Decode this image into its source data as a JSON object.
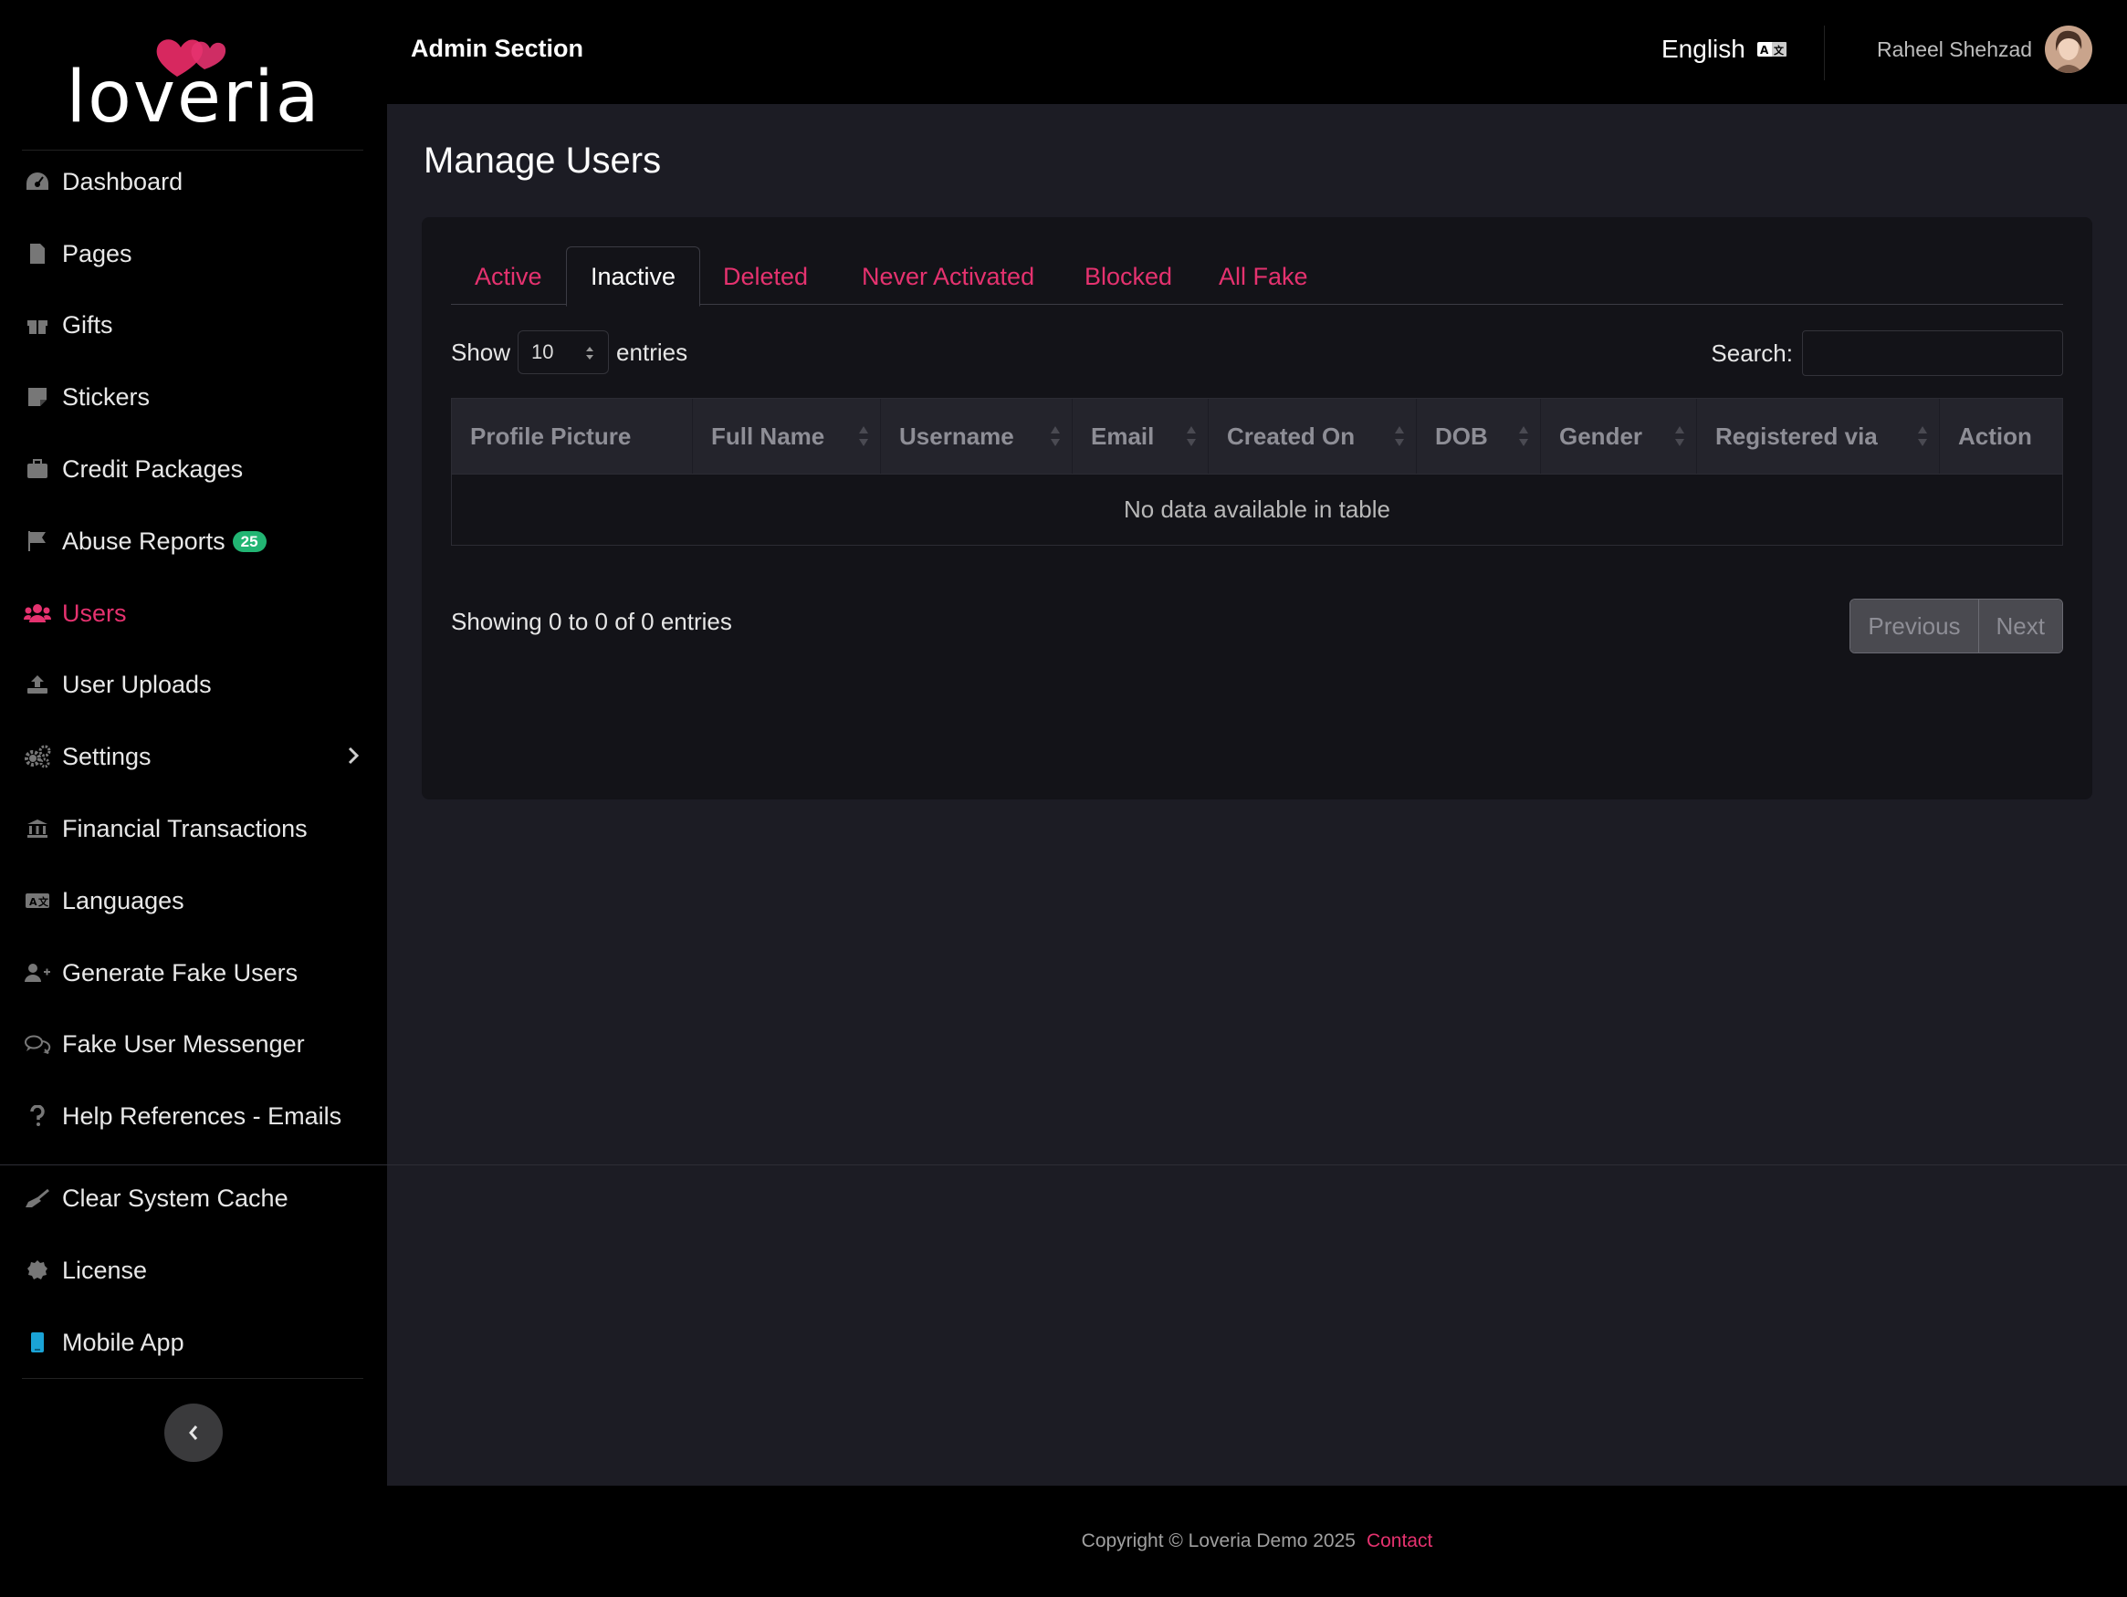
{
  "brand": {
    "name": "loveria",
    "accent": "#e5326f",
    "heart_color": "#d7285f"
  },
  "header": {
    "title": "Admin Section",
    "language": "English",
    "user_name": "Raheel Shehzad"
  },
  "sidebar": {
    "items": [
      {
        "label": "Dashboard",
        "icon": "dashboard-icon"
      },
      {
        "label": "Pages",
        "icon": "file-icon"
      },
      {
        "label": "Gifts",
        "icon": "gift-icon"
      },
      {
        "label": "Stickers",
        "icon": "sticker-icon"
      },
      {
        "label": "Credit Packages",
        "icon": "briefcase-icon"
      },
      {
        "label": "Abuse Reports",
        "icon": "flag-icon",
        "badge": "25"
      },
      {
        "label": "Users",
        "icon": "users-icon",
        "active": true
      },
      {
        "label": "User Uploads",
        "icon": "upload-icon"
      },
      {
        "label": "Settings",
        "icon": "cogs-icon"
      },
      {
        "label": "Financial Transactions",
        "icon": "bank-icon"
      },
      {
        "label": "Languages",
        "icon": "language-icon"
      },
      {
        "label": "Generate Fake Users",
        "icon": "user-plus-icon"
      },
      {
        "label": "Fake User Messenger",
        "icon": "comments-icon"
      },
      {
        "label": "Help References - Emails",
        "icon": "question-icon"
      },
      {
        "label": "Clear System Cache",
        "icon": "broom-icon"
      },
      {
        "label": "License",
        "icon": "certificate-icon"
      },
      {
        "label": "Mobile App",
        "icon": "mobile-icon"
      }
    ]
  },
  "main": {
    "page_title": "Manage Users",
    "tabs": [
      {
        "label": "Active"
      },
      {
        "label": "Inactive",
        "active": true
      },
      {
        "label": "Deleted"
      },
      {
        "label": "Never Activated"
      },
      {
        "label": "Blocked"
      },
      {
        "label": "All Fake"
      }
    ],
    "length": {
      "show_label": "Show",
      "value": "10",
      "entries_label": "entries"
    },
    "search_label": "Search:",
    "search_value": "",
    "columns": [
      "Profile Picture",
      "Full Name",
      "Username",
      "Email",
      "Created On",
      "DOB",
      "Gender",
      "Registered via",
      "Action"
    ],
    "empty_message": "No data available in table",
    "info": "Showing 0 to 0 of 0 entries",
    "pager": {
      "previous": "Previous",
      "next": "Next"
    }
  },
  "footer": {
    "copyright": "Copyright © Loveria Demo 2025",
    "contact": "Contact"
  }
}
